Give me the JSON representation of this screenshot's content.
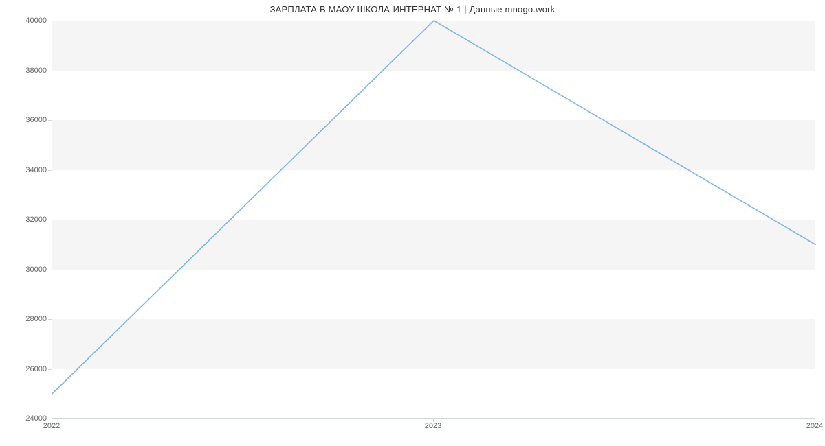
{
  "chart_data": {
    "type": "line",
    "title": "ЗАРПЛАТА В МАОУ ШКОЛА-ИНТЕРНАТ № 1 | Данные mnogo.work",
    "xlabel": "",
    "ylabel": "",
    "x": [
      2022,
      2023,
      2024
    ],
    "values": [
      25000,
      40000,
      31000
    ],
    "xlim": [
      2022,
      2024
    ],
    "ylim": [
      24000,
      40000
    ],
    "yticks": [
      24000,
      26000,
      28000,
      30000,
      32000,
      34000,
      36000,
      38000,
      40000
    ],
    "xticks": [
      2022,
      2023,
      2024
    ],
    "grid_bands": true,
    "line_color": "#7cb5ec"
  }
}
